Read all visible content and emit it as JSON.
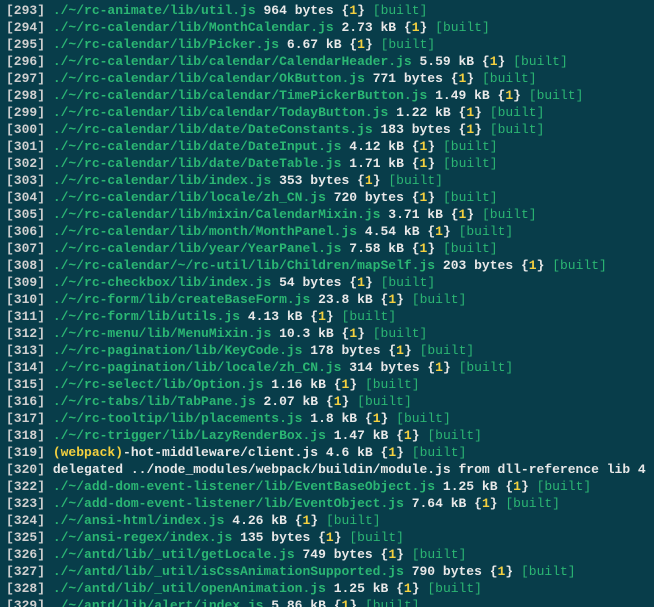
{
  "chart_data": {
    "type": "table"
  },
  "built_label": "[built]",
  "rows": [
    {
      "n": "293",
      "path": "./~/rc-animate/lib/util.js",
      "size": "964 bytes",
      "count": "1",
      "built": true
    },
    {
      "n": "294",
      "path": "./~/rc-calendar/lib/MonthCalendar.js",
      "size": "2.73 kB",
      "count": "1",
      "built": true
    },
    {
      "n": "295",
      "path": "./~/rc-calendar/lib/Picker.js",
      "size": "6.67 kB",
      "count": "1",
      "built": true
    },
    {
      "n": "296",
      "path": "./~/rc-calendar/lib/calendar/CalendarHeader.js",
      "size": "5.59 kB",
      "count": "1",
      "built": true
    },
    {
      "n": "297",
      "path": "./~/rc-calendar/lib/calendar/OkButton.js",
      "size": "771 bytes",
      "count": "1",
      "built": true
    },
    {
      "n": "298",
      "path": "./~/rc-calendar/lib/calendar/TimePickerButton.js",
      "size": "1.49 kB",
      "count": "1",
      "built": true
    },
    {
      "n": "299",
      "path": "./~/rc-calendar/lib/calendar/TodayButton.js",
      "size": "1.22 kB",
      "count": "1",
      "built": true
    },
    {
      "n": "300",
      "path": "./~/rc-calendar/lib/date/DateConstants.js",
      "size": "183 bytes",
      "count": "1",
      "built": true
    },
    {
      "n": "301",
      "path": "./~/rc-calendar/lib/date/DateInput.js",
      "size": "4.12 kB",
      "count": "1",
      "built": true
    },
    {
      "n": "302",
      "path": "./~/rc-calendar/lib/date/DateTable.js",
      "size": "1.71 kB",
      "count": "1",
      "built": true
    },
    {
      "n": "303",
      "path": "./~/rc-calendar/lib/index.js",
      "size": "353 bytes",
      "count": "1",
      "built": true
    },
    {
      "n": "304",
      "path": "./~/rc-calendar/lib/locale/zh_CN.js",
      "size": "720 bytes",
      "count": "1",
      "built": true
    },
    {
      "n": "305",
      "path": "./~/rc-calendar/lib/mixin/CalendarMixin.js",
      "size": "3.71 kB",
      "count": "1",
      "built": true
    },
    {
      "n": "306",
      "path": "./~/rc-calendar/lib/month/MonthPanel.js",
      "size": "4.54 kB",
      "count": "1",
      "built": true
    },
    {
      "n": "307",
      "path": "./~/rc-calendar/lib/year/YearPanel.js",
      "size": "7.58 kB",
      "count": "1",
      "built": true
    },
    {
      "n": "308",
      "path": "./~/rc-calendar/~/rc-util/lib/Children/mapSelf.js",
      "size": "203 bytes",
      "count": "1",
      "built": true
    },
    {
      "n": "309",
      "path": "./~/rc-checkbox/lib/index.js",
      "size": "54 bytes",
      "count": "1",
      "built": true
    },
    {
      "n": "310",
      "path": "./~/rc-form/lib/createBaseForm.js",
      "size": "23.8 kB",
      "count": "1",
      "built": true
    },
    {
      "n": "311",
      "path": "./~/rc-form/lib/utils.js",
      "size": "4.13 kB",
      "count": "1",
      "built": true
    },
    {
      "n": "312",
      "path": "./~/rc-menu/lib/MenuMixin.js",
      "size": "10.3 kB",
      "count": "1",
      "built": true
    },
    {
      "n": "313",
      "path": "./~/rc-pagination/lib/KeyCode.js",
      "size": "178 bytes",
      "count": "1",
      "built": true
    },
    {
      "n": "314",
      "path": "./~/rc-pagination/lib/locale/zh_CN.js",
      "size": "314 bytes",
      "count": "1",
      "built": true
    },
    {
      "n": "315",
      "path": "./~/rc-select/lib/Option.js",
      "size": "1.16 kB",
      "count": "1",
      "built": true
    },
    {
      "n": "316",
      "path": "./~/rc-tabs/lib/TabPane.js",
      "size": "2.07 kB",
      "count": "1",
      "built": true
    },
    {
      "n": "317",
      "path": "./~/rc-tooltip/lib/placements.js",
      "size": "1.8 kB",
      "count": "1",
      "built": true
    },
    {
      "n": "318",
      "path": "./~/rc-trigger/lib/LazyRenderBox.js",
      "size": "1.47 kB",
      "count": "1",
      "built": true
    },
    {
      "n": "319",
      "type": "webpack-hmr",
      "prefix": "(webpack)",
      "suffix": "-hot-middleware/client.js",
      "size": "4.6 kB",
      "count": "1",
      "built": true
    },
    {
      "n": "320",
      "type": "delegated",
      "text": "delegated ../node_modules/webpack/buildin/module.js from dll-reference lib 4"
    },
    {
      "n": "322",
      "path": "./~/add-dom-event-listener/lib/EventBaseObject.js",
      "size": "1.25 kB",
      "count": "1",
      "built": true
    },
    {
      "n": "323",
      "path": "./~/add-dom-event-listener/lib/EventObject.js",
      "size": "7.64 kB",
      "count": "1",
      "built": true
    },
    {
      "n": "324",
      "path": "./~/ansi-html/index.js",
      "size": "4.26 kB",
      "count": "1",
      "built": true
    },
    {
      "n": "325",
      "path": "./~/ansi-regex/index.js",
      "size": "135 bytes",
      "count": "1",
      "built": true
    },
    {
      "n": "326",
      "path": "./~/antd/lib/_util/getLocale.js",
      "size": "749 bytes",
      "count": "1",
      "built": true
    },
    {
      "n": "327",
      "path": "./~/antd/lib/_util/isCssAnimationSupported.js",
      "size": "790 bytes",
      "count": "1",
      "built": true
    },
    {
      "n": "328",
      "path": "./~/antd/lib/_util/openAnimation.js",
      "size": "1.25 kB",
      "count": "1",
      "built": true
    },
    {
      "n": "329",
      "path": "./~/antd/lib/alert/index.js",
      "size": "5.86 kB",
      "count": "1",
      "built": true
    }
  ]
}
